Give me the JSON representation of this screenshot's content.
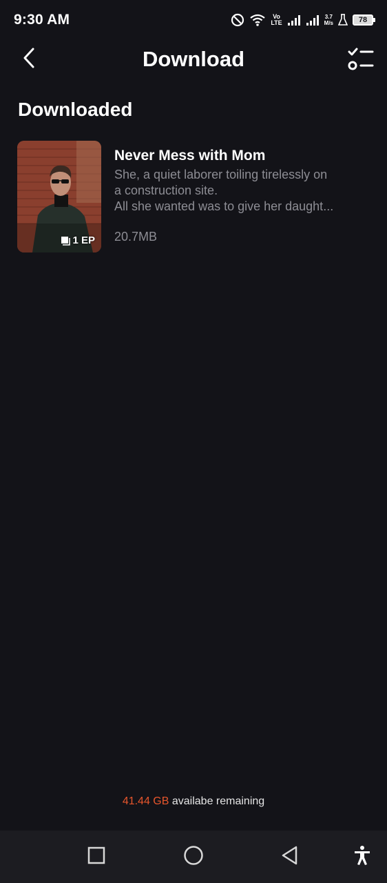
{
  "status_bar": {
    "time": "9:30 AM",
    "lte_top": "Vo",
    "lte_bottom": "LTE",
    "speed_value": "3.7",
    "speed_unit": "M/s",
    "battery_level": "78",
    "icons": [
      "dnd-icon",
      "wifi-icon",
      "signal-icon",
      "signal-icon",
      "flask-icon",
      "battery-icon"
    ]
  },
  "app_bar": {
    "title": "Download",
    "back_icon": "chevron-left-icon",
    "edit_icon": "checklist-icon"
  },
  "section": {
    "heading": "Downloaded"
  },
  "downloads": [
    {
      "title": "Never Mess with Mom",
      "description_line1": "She, a quiet laborer toiling tirelessly on",
      "description_line2": "a construction site.",
      "description_line3": "All she wanted was to give her daught...",
      "size": "20.7MB",
      "episodes": "1 EP"
    }
  ],
  "storage": {
    "amount": "41.44 GB",
    "label": "availabe remaining"
  },
  "nav_bar": {
    "icons": [
      "recents-square-icon",
      "home-circle-icon",
      "back-triangle-icon",
      "accessibility-icon"
    ]
  },
  "colors": {
    "background": "#131318",
    "accent": "#e8562c",
    "secondary_text": "#8d8d94"
  }
}
